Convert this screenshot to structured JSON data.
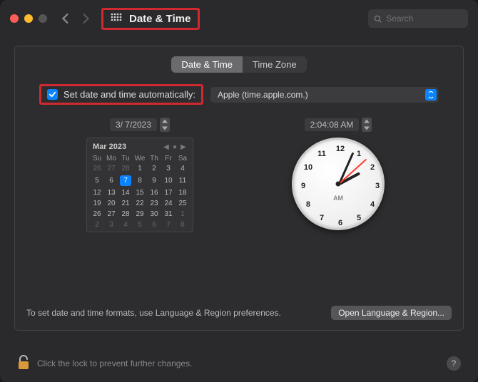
{
  "header": {
    "title": "Date & Time",
    "search_placeholder": "Search"
  },
  "tabs": {
    "date_time": "Date & Time",
    "time_zone": "Time Zone"
  },
  "auto": {
    "label": "Set date and time automatically:",
    "server": "Apple (time.apple.com.)"
  },
  "date": {
    "field": "3/ 7/2023",
    "cal_title": "Mar 2023",
    "dow": [
      "Su",
      "Mo",
      "Tu",
      "We",
      "Th",
      "Fr",
      "Sa"
    ],
    "weeks": [
      [
        {
          "d": "26",
          "o": true
        },
        {
          "d": "27",
          "o": true
        },
        {
          "d": "28",
          "o": true
        },
        {
          "d": "1"
        },
        {
          "d": "2"
        },
        {
          "d": "3"
        },
        {
          "d": "4"
        }
      ],
      [
        {
          "d": "5"
        },
        {
          "d": "6"
        },
        {
          "d": "7",
          "t": true
        },
        {
          "d": "8"
        },
        {
          "d": "9"
        },
        {
          "d": "10"
        },
        {
          "d": "11"
        }
      ],
      [
        {
          "d": "12"
        },
        {
          "d": "13"
        },
        {
          "d": "14"
        },
        {
          "d": "15"
        },
        {
          "d": "16"
        },
        {
          "d": "17"
        },
        {
          "d": "18"
        }
      ],
      [
        {
          "d": "19"
        },
        {
          "d": "20"
        },
        {
          "d": "21"
        },
        {
          "d": "22"
        },
        {
          "d": "23"
        },
        {
          "d": "24"
        },
        {
          "d": "25"
        }
      ],
      [
        {
          "d": "26"
        },
        {
          "d": "27"
        },
        {
          "d": "28"
        },
        {
          "d": "29"
        },
        {
          "d": "30"
        },
        {
          "d": "31"
        },
        {
          "d": "1",
          "o": true
        }
      ],
      [
        {
          "d": "2",
          "o": true
        },
        {
          "d": "3",
          "o": true
        },
        {
          "d": "4",
          "o": true
        },
        {
          "d": "5",
          "o": true
        },
        {
          "d": "6",
          "o": true
        },
        {
          "d": "7",
          "o": true
        },
        {
          "d": "8",
          "o": true
        }
      ]
    ]
  },
  "time": {
    "field": "2:04:08 AM",
    "ampm": "AM",
    "numbers": [
      "12",
      "1",
      "2",
      "3",
      "4",
      "5",
      "6",
      "7",
      "8",
      "9",
      "10",
      "11"
    ]
  },
  "hint": {
    "text": "To set date and time formats, use Language & Region preferences.",
    "button": "Open Language & Region..."
  },
  "footer": {
    "text": "Click the lock to prevent further changes.",
    "help": "?"
  }
}
